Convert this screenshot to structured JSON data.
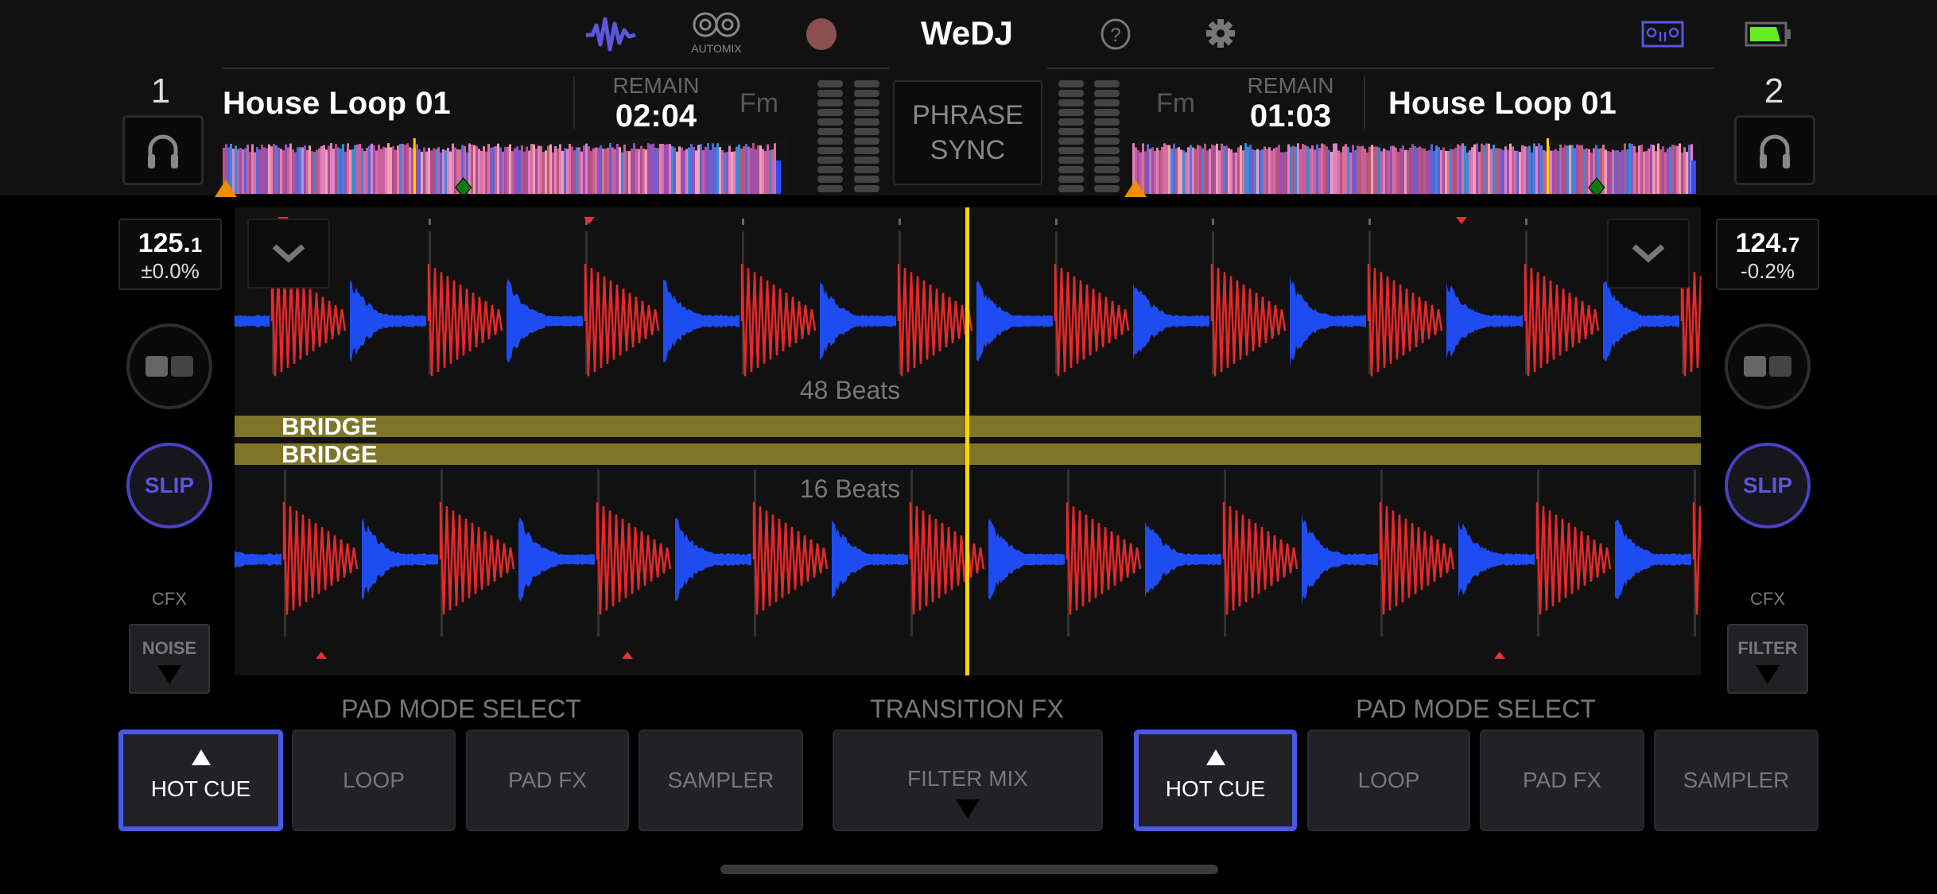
{
  "app": {
    "title": "WeDJ",
    "automix_label": "AUTOMIX"
  },
  "header_icons": [
    "waveform-icon",
    "automix-icon",
    "record-icon",
    "help-icon",
    "gear-icon",
    "deck-device-icon",
    "battery-icon"
  ],
  "colors": {
    "accent": "#5b55e0",
    "active_pad": "#4a5ae6",
    "phrase_bar": "#7e7528",
    "playhead": "#ffd400",
    "battery": "#66ee22"
  },
  "phrase_sync": {
    "line1": "PHRASE",
    "line2": "SYNC"
  },
  "decks": [
    {
      "number": "1",
      "title": "House Loop 01",
      "remain_label": "REMAIN",
      "remain": "02:04",
      "key": "Fm",
      "bpm_int": "125.",
      "bpm_dec": "1",
      "pitch": "±0.0%",
      "slip": "SLIP",
      "cfx_label": "CFX",
      "cfx": "NOISE",
      "phrase": "BRIDGE",
      "beats": "48 Beats",
      "playhead_progress": 0.34
    },
    {
      "number": "2",
      "title": "House Loop 01",
      "remain_label": "REMAIN",
      "remain": "01:03",
      "key": "Fm",
      "bpm_int": "124.",
      "bpm_dec": "7",
      "pitch": "-0.2%",
      "slip": "SLIP",
      "cfx_label": "CFX",
      "cfx": "FILTER",
      "phrase": "BRIDGE",
      "beats": "16 Beats",
      "playhead_progress": 0.73
    }
  ],
  "pad_mode": {
    "label": "PAD MODE SELECT",
    "pads": [
      "HOT CUE",
      "LOOP",
      "PAD FX",
      "SAMPLER"
    ],
    "active": "HOT CUE"
  },
  "transition_fx": {
    "label": "TRANSITION FX",
    "value": "FILTER MIX"
  }
}
